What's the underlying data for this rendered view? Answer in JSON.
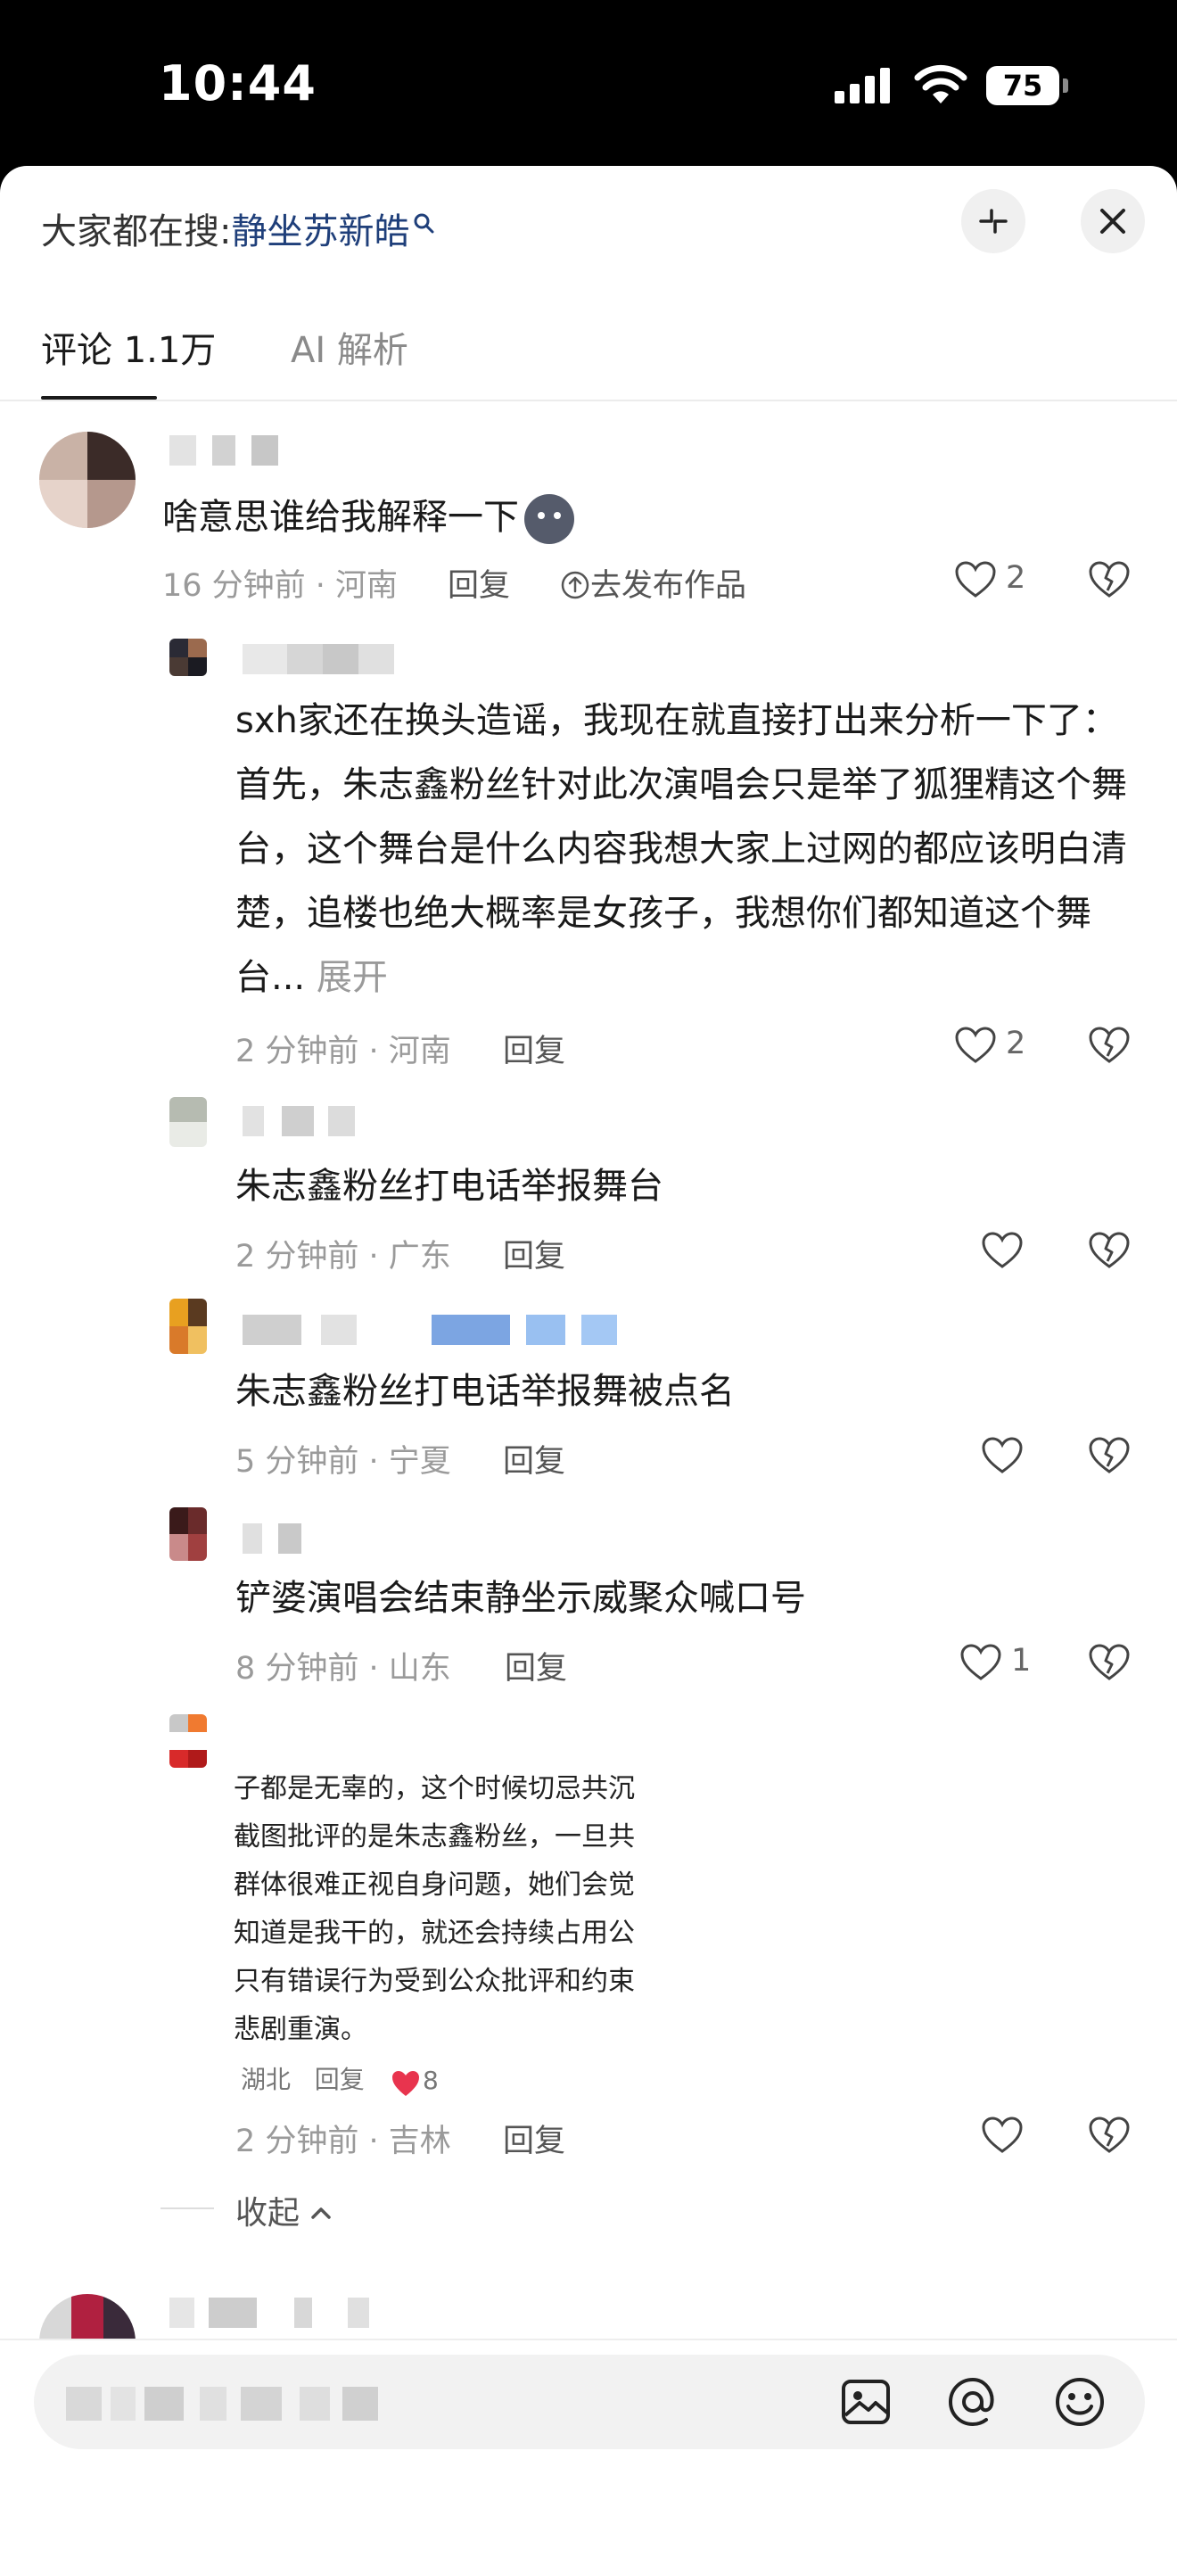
{
  "status_bar": {
    "time": "10:44",
    "battery": "75"
  },
  "header": {
    "search_prefix": "大家都在搜:",
    "search_keyword": "静坐苏新皓"
  },
  "tabs": [
    {
      "label": "评论 1.1万",
      "active": true
    },
    {
      "label": "AI 解析",
      "active": false
    }
  ],
  "comments": [
    {
      "text": "啥意思谁给我解释一下",
      "time_location": "16 分钟前 · 河南",
      "reply_label": "回复",
      "publish_label": "去发布作品",
      "likes": "2"
    },
    {
      "text": "sxh家还在换头造谣，我现在就直接打出来分析一下了：首先，朱志鑫粉丝针对此次演唱会只是举了狐狸精这个舞台，这个舞台是什么内容我想大家上过网的都应该明白清楚，追楼也绝大概率是女孩子，我想你们都知道这个舞台...",
      "expand_label": "展开",
      "time_location": "2 分钟前 · 河南",
      "reply_label": "回复",
      "likes": "2"
    },
    {
      "text": "朱志鑫粉丝打电话举报舞台",
      "time_location": "2 分钟前 · 广东",
      "reply_label": "回复",
      "likes": ""
    },
    {
      "text": "朱志鑫粉丝打电话举报舞被点名",
      "time_location": "5 分钟前 · 宁夏",
      "reply_label": "回复",
      "likes": ""
    },
    {
      "text": "铲婆演唱会结束静坐示威聚众喊口号",
      "time_location": "8 分钟前 · 山东",
      "reply_label": "回复",
      "likes": "1"
    },
    {
      "image_lines": [
        "子都是无辜的，这个时候切忌共沉",
        "截图批评的是朱志鑫粉丝，一旦共",
        "群体很难正视自身问题，她们会觉",
        "知道是我干的，就还会持续占用公",
        "只有错误行为受到公众批评和约束",
        "悲剧重演。"
      ],
      "image_meta_location": "湖北",
      "image_meta_reply": "回复",
      "image_meta_likes": "8",
      "time_location": "2 分钟前 · 吉林",
      "reply_label": "回复",
      "likes": ""
    }
  ],
  "collapse_label": "收起",
  "icons": {
    "close": "close-icon",
    "minimize": "minimize-icon",
    "search": "search-icon",
    "like": "heart-outline-icon",
    "dislike": "broken-heart-icon",
    "image": "image-icon",
    "mention": "at-icon",
    "emoji": "emoji-icon"
  },
  "colors": {
    "keyword": "#1f3f7a",
    "liked": "#e8344e"
  }
}
